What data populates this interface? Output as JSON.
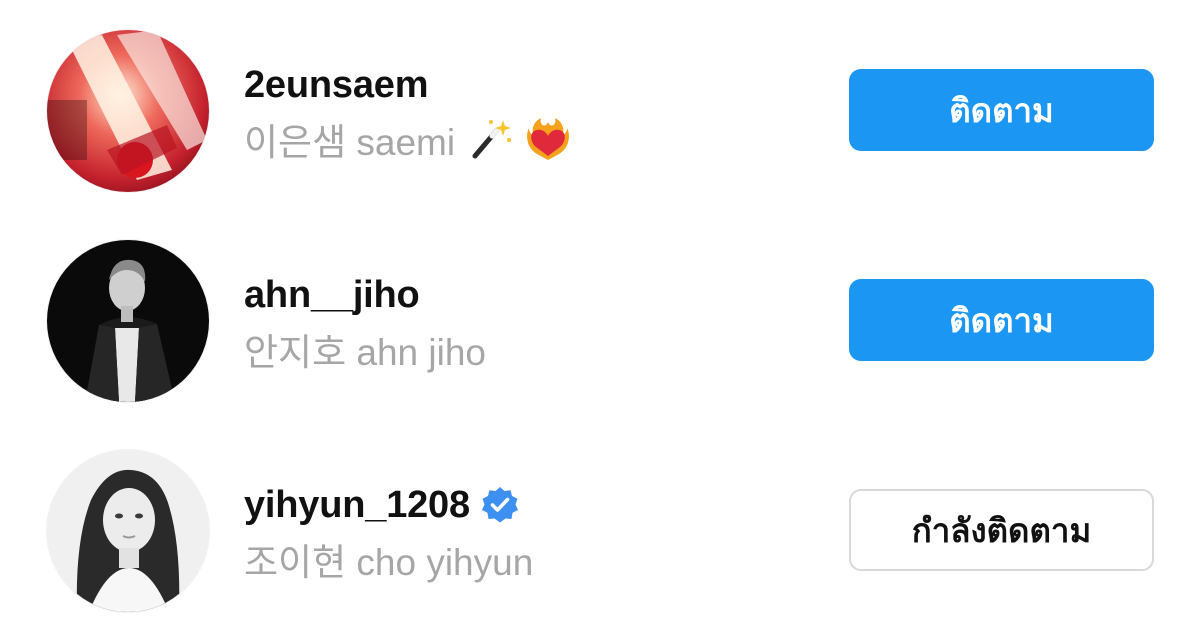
{
  "accounts": [
    {
      "username": "2eunsaem",
      "full_name": "이은샘 saemi",
      "name_emojis": [
        "magic-wand-icon",
        "heart-on-fire-icon"
      ],
      "verified": false,
      "button_label": "ติดตาม",
      "button_state": "follow"
    },
    {
      "username": "ahn__jiho",
      "full_name": "안지호 ahn jiho",
      "name_emojis": [],
      "verified": false,
      "button_label": "ติดตาม",
      "button_state": "follow"
    },
    {
      "username": "yihyun_1208",
      "full_name": "조이현 cho yihyun",
      "name_emojis": [],
      "verified": true,
      "button_label": "กำลังติดตาม",
      "button_state": "following"
    }
  ],
  "colors": {
    "follow_button_bg": "#1c96f3",
    "follow_button_text": "#ffffff",
    "following_button_border": "#d9d9d9",
    "username_text": "#111111",
    "fullname_text": "#a6a6a6",
    "verified_badge": "#3d8ff0"
  }
}
